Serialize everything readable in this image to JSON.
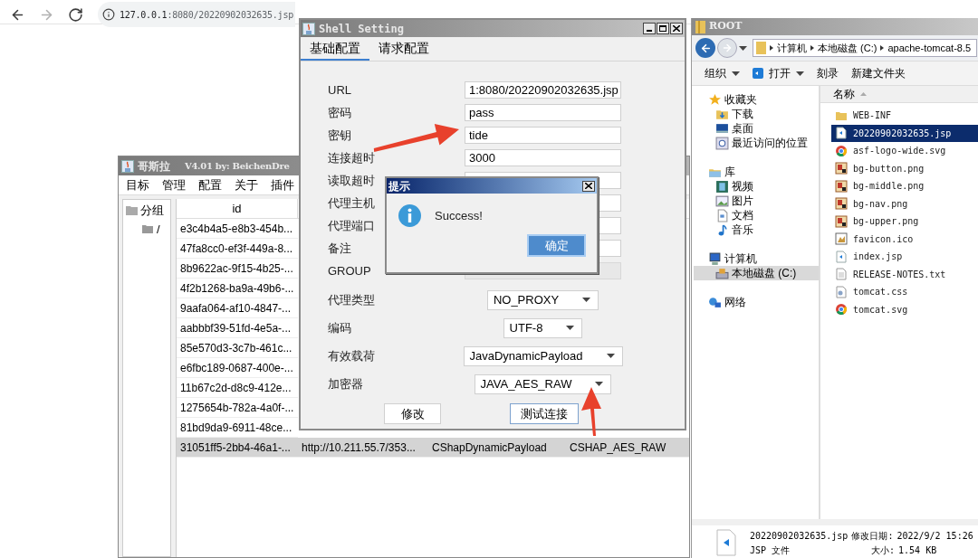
{
  "browser": {
    "nav": [
      {
        "kind": "back",
        "disabled": false
      },
      {
        "kind": "forward",
        "disabled": true
      },
      {
        "kind": "reload",
        "disabled": false
      }
    ],
    "host": "127.0.0.1",
    "path": ":8080/20220902032635.jsp"
  },
  "godzilla": {
    "title": "哥斯拉",
    "subtitle": "V4.01 by: BeichenDre",
    "menu": [
      "目标",
      "管理",
      "配置",
      "关于",
      "插件"
    ],
    "tree": {
      "label": "分组",
      "children": [
        {
          "label": "/"
        }
      ]
    },
    "table": {
      "columns": [
        "id"
      ],
      "rows": [
        {
          "cells": [
            "e3c4b4a5-e8b3-454b..."
          ],
          "selected": false
        },
        {
          "cells": [
            "47fa8cc0-ef3f-449a-8..."
          ],
          "selected": false
        },
        {
          "cells": [
            "8b9622ac-9f15-4b25-..."
          ],
          "selected": false
        },
        {
          "cells": [
            "4f2b1268-ba9a-49b6-..."
          ],
          "selected": false
        },
        {
          "cells": [
            "9aafa064-af10-4847-..."
          ],
          "selected": false
        },
        {
          "cells": [
            "aabbbf39-51fd-4e5a-..."
          ],
          "selected": false
        },
        {
          "cells": [
            "85e570d3-3c7b-461c..."
          ],
          "selected": false
        },
        {
          "cells": [
            "e6fbc189-0687-400e-..."
          ],
          "selected": false
        },
        {
          "cells": [
            "11b67c2d-d8c9-412e..."
          ],
          "selected": false
        },
        {
          "cells": [
            "1275654b-782a-4a0f-..."
          ],
          "selected": false
        },
        {
          "cells": [
            "81bd9da9-6911-48ce..."
          ],
          "selected": false
        },
        {
          "cells": [
            "31051ff5-2bb4-46a1-...",
            "http://10.211.55.7/353...",
            "CShapDynamicPayload",
            "CSHAP_AES_RAW"
          ],
          "selected": true
        }
      ]
    }
  },
  "shell_setting": {
    "title": "Shell Setting",
    "tabs": [
      {
        "label": "基础配置",
        "selected": true
      },
      {
        "label": "请求配置",
        "selected": false
      }
    ],
    "fields": [
      {
        "label": "URL",
        "value": "1:8080/20220902032635.jsp",
        "disabled": false
      },
      {
        "label": "密码",
        "value": "pass",
        "disabled": false
      },
      {
        "label": "密钥",
        "value": "tide",
        "disabled": false
      },
      {
        "label": "连接超时",
        "value": "3000",
        "disabled": false
      },
      {
        "label": "读取超时",
        "disabled": false
      },
      {
        "label": "代理主机",
        "disabled": false
      },
      {
        "label": "代理端口",
        "disabled": false
      },
      {
        "label": "备注",
        "disabled": false
      },
      {
        "label": "GROUP",
        "disabled": true
      }
    ],
    "selects": [
      {
        "label": "代理类型",
        "value": "NO_PROXY"
      },
      {
        "label": "编码",
        "value": "UTF-8"
      },
      {
        "label": "有效载荷",
        "value": "JavaDynamicPayload"
      },
      {
        "label": "加密器",
        "value": "JAVA_AES_RAW"
      }
    ],
    "buttons": [
      {
        "label": "修改",
        "focused": false
      },
      {
        "label": "测试连接",
        "focused": true
      }
    ]
  },
  "dialog": {
    "title": "提示",
    "message": "Success!",
    "button": "确定"
  },
  "explorer": {
    "title": "ROOT",
    "breadcrumb": [
      "计算机",
      "本地磁盘 (C:)",
      "apache-tomcat-8.5"
    ],
    "toolbar": [
      {
        "label": "组织",
        "kind": "menu"
      },
      {
        "label": "打开",
        "kind": "app-menu"
      },
      {
        "label": "刻录",
        "kind": "button"
      },
      {
        "label": "新建文件夹",
        "kind": "button"
      }
    ],
    "nav": [
      {
        "label": "收藏夹",
        "kind": "favorites",
        "selected": false,
        "children": [
          {
            "label": "下载",
            "kind": "downloads",
            "selected": false
          },
          {
            "label": "桌面",
            "kind": "desktop",
            "selected": false
          },
          {
            "label": "最近访问的位置",
            "kind": "recent",
            "selected": false
          }
        ]
      },
      {
        "label": "库",
        "kind": "library",
        "selected": false,
        "children": [
          {
            "label": "视频",
            "kind": "video",
            "selected": false
          },
          {
            "label": "图片",
            "kind": "pictures",
            "selected": false
          },
          {
            "label": "文档",
            "kind": "documents",
            "selected": false
          },
          {
            "label": "音乐",
            "kind": "music",
            "selected": false
          }
        ]
      },
      {
        "label": "计算机",
        "kind": "computer",
        "selected": false,
        "children": [
          {
            "label": "本地磁盘 (C:)",
            "kind": "disk",
            "selected": true
          }
        ]
      },
      {
        "label": "网络",
        "kind": "network",
        "selected": false
      }
    ],
    "column": "名称",
    "files": [
      {
        "name": "WEB-INF",
        "kind": "folder",
        "selected": false
      },
      {
        "name": "20220902032635.jsp",
        "kind": "jsp",
        "selected": true
      },
      {
        "name": "asf-logo-wide.svg",
        "kind": "chrome",
        "selected": false
      },
      {
        "name": "bg-button.png",
        "kind": "image",
        "selected": false
      },
      {
        "name": "bg-middle.png",
        "kind": "image",
        "selected": false
      },
      {
        "name": "bg-nav.png",
        "kind": "image",
        "selected": false
      },
      {
        "name": "bg-upper.png",
        "kind": "image",
        "selected": false
      },
      {
        "name": "favicon.ico",
        "kind": "icon",
        "selected": false
      },
      {
        "name": "index.jsp",
        "kind": "jsp",
        "selected": false
      },
      {
        "name": "RELEASE-NOTES.txt",
        "kind": "text",
        "selected": false
      },
      {
        "name": "tomcat.css",
        "kind": "css",
        "selected": false
      },
      {
        "name": "tomcat.svg",
        "kind": "chrome",
        "selected": false
      }
    ],
    "details": {
      "name": "20220902032635.jsp",
      "modified_label": "修改日期:",
      "modified": "2022/9/2 15:26",
      "type": "JSP 文件",
      "size_label": "大小:",
      "size": "1.54 KB"
    }
  }
}
